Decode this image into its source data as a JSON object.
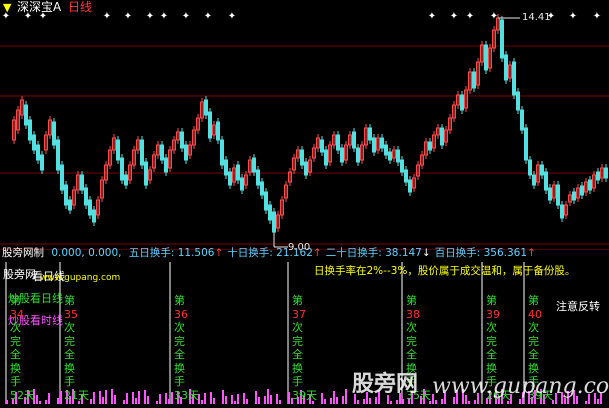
{
  "header": {
    "arrow_icon": "down-arrow-icon",
    "stock_name": "深深宝A",
    "period": "日线",
    "colors": {
      "stock_name": "#ffffff",
      "period": "#ff3b3b"
    }
  },
  "price_chart": {
    "high_label": "14.41",
    "low_label": "9.00",
    "marker_icon": "diamond-icon",
    "colors": {
      "up": "#ff4a4a",
      "down": "#54e0e0",
      "grid": "#7a0000",
      "label": "#e8e8e8"
    }
  },
  "indicator_bar": {
    "title": "股旁网制",
    "values": "0.000, 0.000, ",
    "items": [
      {
        "label": "五日换手",
        "value": "11.506",
        "arrow": "↑"
      },
      {
        "label": "十日换手",
        "value": "21.162",
        "arrow": "↑"
      },
      {
        "label": "二十日换手",
        "value": "38.147",
        "arrow": "↓"
      },
      {
        "label": "百日换手",
        "value": "356.361",
        "arrow": "↑"
      }
    ],
    "colors": {
      "title": "#ffffff",
      "values": "#5fd3ff",
      "arrow_up": "#ff4040",
      "arrow_down": "#ffffff"
    }
  },
  "lower_panel": {
    "watermark_url": "www.gupang.com",
    "overlay_left": "股旁网",
    "overlay_label": "炒股看日线",
    "overlay_label2": "看日线",
    "hint": "日换手率在2%--3%，股价属于成交温和，属于备份股。",
    "legend_day": "炒股看日线",
    "legend_min": "炒股看时线",
    "notice": "注意反转",
    "labels": {
      "di": "第",
      "ci": "次",
      "wan": "完",
      "quan": "全",
      "huan": "换",
      "shou": "手"
    },
    "columns": [
      {
        "num": "34",
        "days": "52天"
      },
      {
        "num": "35",
        "days": "21天"
      },
      {
        "num": "36",
        "days": "33天"
      },
      {
        "num": "37",
        "days": "39天"
      },
      {
        "num": "38",
        "days": "35天"
      },
      {
        "num": "39",
        "days": "26天"
      },
      {
        "num": "40",
        "days": "39天"
      }
    ],
    "colors": {
      "text_green": "#33dd33",
      "num_red": "#ff3030",
      "hint_yellow": "#ffff00",
      "legend_pink": "#ff55ff",
      "notice": "#ffffff",
      "vline": "#ffffff",
      "volume": "#ff55ff"
    }
  },
  "watermark": {
    "brand": "股旁网",
    "url": "www.gupang.com"
  }
}
